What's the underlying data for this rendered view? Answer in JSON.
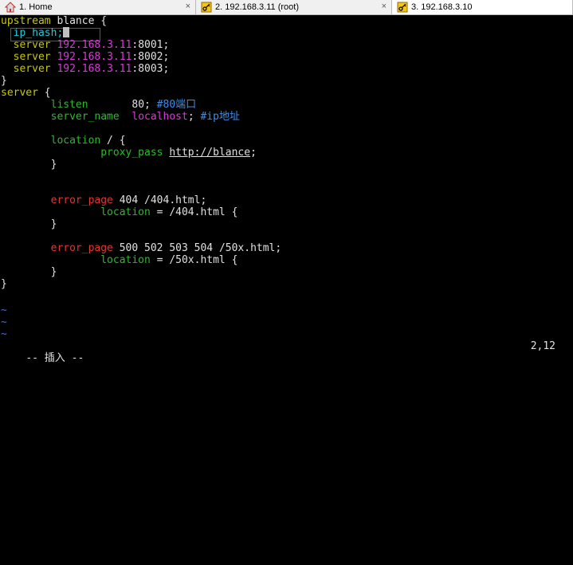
{
  "tabs": [
    {
      "label": "1. Home",
      "icon": "home-icon",
      "active": false
    },
    {
      "label": "2. 192.168.3.11 (root)",
      "icon": "key-icon",
      "active": false
    },
    {
      "label": "3. 192.168.3.10",
      "icon": "key-icon",
      "active": true
    }
  ],
  "tab_close_glyph": "×",
  "editor": {
    "l1": {
      "kw": "upstream",
      "name": " blance {"
    },
    "l2": {
      "text": "  ip_hash;"
    },
    "l3": {
      "kw": "  server ",
      "ip": "192.168.3.11",
      "rest": ":8001;"
    },
    "l4": {
      "kw": "  server ",
      "ip": "192.168.3.11",
      "rest": ":8002;"
    },
    "l5": {
      "kw": "  server ",
      "ip": "192.168.3.11",
      "rest": ":8003;"
    },
    "l6": {
      "text": "}"
    },
    "l7": {
      "kw": "server",
      "rest": " {"
    },
    "l8": {
      "dir": "        listen",
      "val": "       80; ",
      "comment": "#80端口"
    },
    "l9": {
      "dir": "        server_name",
      "val": "  localhost",
      "semi": "; ",
      "comment": "#ip地址"
    },
    "l10": {
      "dir": "        location",
      "rest": " / {"
    },
    "l11": {
      "dir": "                proxy_pass",
      "sp": " ",
      "url": "http://blance",
      "rest": ";"
    },
    "l12": {
      "text": "        }"
    },
    "l13": {
      "dir": "        error_page",
      "rest": " 404 /404.html;"
    },
    "l14": {
      "dir": "                location",
      "rest": " = /404.html {"
    },
    "l15": {
      "text": "        }"
    },
    "l16": {
      "dir": "        error_page",
      "rest": " 500 502 503 504 /50x.html;"
    },
    "l17": {
      "dir": "                location",
      "rest": " = /50x.html {"
    },
    "l18": {
      "text": "        }"
    },
    "l19": {
      "text": "}"
    },
    "tilde": "~"
  },
  "status": {
    "mode": "-- 插入 --",
    "position": "2,12"
  },
  "colors": {
    "highlight_box": "#e02020",
    "background": "#000000"
  }
}
